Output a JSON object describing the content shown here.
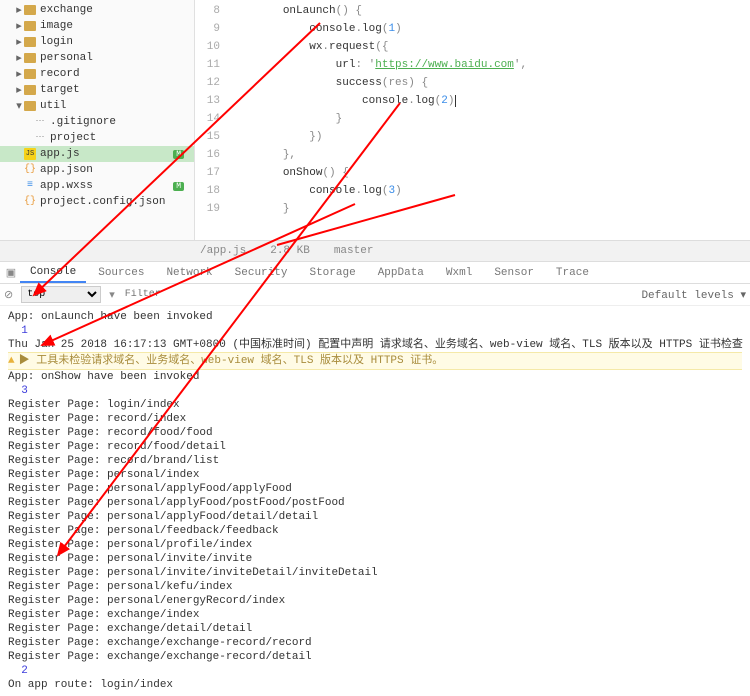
{
  "sidebar": {
    "items": [
      {
        "label": "exchange",
        "type": "folder",
        "open": false,
        "depth": 1
      },
      {
        "label": "image",
        "type": "folder",
        "open": false,
        "depth": 1
      },
      {
        "label": "login",
        "type": "folder",
        "open": false,
        "depth": 1
      },
      {
        "label": "personal",
        "type": "folder",
        "open": false,
        "depth": 1
      },
      {
        "label": "record",
        "type": "folder",
        "open": false,
        "depth": 1
      },
      {
        "label": "target",
        "type": "folder",
        "open": false,
        "depth": 1
      },
      {
        "label": "util",
        "type": "folder",
        "open": true,
        "depth": 1
      },
      {
        "label": ".gitignore",
        "type": "cfg",
        "depth": 2
      },
      {
        "label": "project",
        "type": "cfg",
        "depth": 2
      },
      {
        "label": "app.js",
        "type": "js",
        "badge": "M",
        "selected": true,
        "depth": 1
      },
      {
        "label": "app.json",
        "type": "json",
        "depth": 1
      },
      {
        "label": "app.wxss",
        "type": "wxss",
        "badge": "M",
        "depth": 1
      },
      {
        "label": "project.config.json",
        "type": "json",
        "depth": 1
      }
    ]
  },
  "editor": {
    "lines": [
      {
        "n": 8,
        "indent": 2,
        "tokens": [
          {
            "t": "onLaunch",
            "c": "fn"
          },
          {
            "t": "() {",
            "c": "punct"
          }
        ]
      },
      {
        "n": 9,
        "indent": 3,
        "tokens": [
          {
            "t": "console",
            "c": "kw"
          },
          {
            "t": ".",
            "c": "punct"
          },
          {
            "t": "log",
            "c": "fn"
          },
          {
            "t": "(",
            "c": "punct"
          },
          {
            "t": "1",
            "c": "num"
          },
          {
            "t": ")",
            "c": "punct"
          }
        ]
      },
      {
        "n": 10,
        "indent": 3,
        "tokens": [
          {
            "t": "wx",
            "c": "kw"
          },
          {
            "t": ".",
            "c": "punct"
          },
          {
            "t": "request",
            "c": "fn"
          },
          {
            "t": "({",
            "c": "punct"
          }
        ]
      },
      {
        "n": 11,
        "indent": 4,
        "tokens": [
          {
            "t": "url",
            "c": "kw"
          },
          {
            "t": ": '",
            "c": "punct"
          },
          {
            "t": "https://www.baidu.com",
            "c": "str"
          },
          {
            "t": "',",
            "c": "punct"
          }
        ]
      },
      {
        "n": 12,
        "indent": 4,
        "tokens": [
          {
            "t": "success",
            "c": "fn"
          },
          {
            "t": "(res) {",
            "c": "punct"
          }
        ]
      },
      {
        "n": 13,
        "indent": 5,
        "tokens": [
          {
            "t": "console",
            "c": "kw"
          },
          {
            "t": ".",
            "c": "punct"
          },
          {
            "t": "log",
            "c": "fn"
          },
          {
            "t": "(",
            "c": "punct"
          },
          {
            "t": "2",
            "c": "num"
          },
          {
            "t": ")",
            "c": "punct"
          }
        ],
        "cursor": true
      },
      {
        "n": 14,
        "indent": 4,
        "tokens": [
          {
            "t": "}",
            "c": "punct"
          }
        ]
      },
      {
        "n": 15,
        "indent": 3,
        "tokens": [
          {
            "t": "})",
            "c": "punct"
          }
        ]
      },
      {
        "n": 16,
        "indent": 2,
        "tokens": [
          {
            "t": "},",
            "c": "punct"
          }
        ]
      },
      {
        "n": 17,
        "indent": 2,
        "tokens": [
          {
            "t": "onShow",
            "c": "fn"
          },
          {
            "t": "() {",
            "c": "punct"
          }
        ]
      },
      {
        "n": 18,
        "indent": 3,
        "tokens": [
          {
            "t": "console",
            "c": "kw"
          },
          {
            "t": ".",
            "c": "punct"
          },
          {
            "t": "log",
            "c": "fn"
          },
          {
            "t": "(",
            "c": "punct"
          },
          {
            "t": "3",
            "c": "num"
          },
          {
            "t": ")",
            "c": "punct"
          }
        ]
      },
      {
        "n": 19,
        "indent": 2,
        "tokens": [
          {
            "t": "}",
            "c": "punct"
          }
        ]
      }
    ]
  },
  "statusbar": {
    "path": "/app.js",
    "size": "2.8 KB",
    "mode": "master"
  },
  "devtools": {
    "tabs": [
      "Console",
      "Sources",
      "Network",
      "Security",
      "Storage",
      "AppData",
      "Wxml",
      "Sensor",
      "Trace"
    ],
    "active": "Console",
    "top_label": "top",
    "filter_placeholder": "Filter",
    "levels": "Default levels ▾"
  },
  "console": {
    "lines": [
      {
        "text": "App: onLaunch have been invoked"
      },
      {
        "text": "1",
        "num": true
      },
      {
        "text": "Thu Jan 25 2018 16:17:13 GMT+0800 (中国标准时间) 配置中声明 请求域名、业务域名、web-view 域名、TLS 版本以及 HTTPS 证书检查"
      },
      {
        "text": "▶ 工具未检验请求域名、业务域名、web-view 域名、TLS 版本以及 HTTPS 证书。",
        "warn": true
      },
      {
        "text": "App: onShow have been invoked"
      },
      {
        "text": "3",
        "num": true
      },
      {
        "text": ""
      },
      {
        "text": "Register Page: login/index"
      },
      {
        "text": "Register Page: record/index"
      },
      {
        "text": "Register Page: record/food/food"
      },
      {
        "text": "Register Page: record/food/detail"
      },
      {
        "text": "Register Page: record/brand/list"
      },
      {
        "text": "Register Page: personal/index"
      },
      {
        "text": "Register Page: personal/applyFood/applyFood"
      },
      {
        "text": "Register Page: personal/applyFood/postFood/postFood"
      },
      {
        "text": "Register Page: personal/applyFood/detail/detail"
      },
      {
        "text": "Register Page: personal/feedback/feedback"
      },
      {
        "text": "Register Page: personal/profile/index"
      },
      {
        "text": "Register Page: personal/invite/invite"
      },
      {
        "text": "Register Page: personal/invite/inviteDetail/inviteDetail"
      },
      {
        "text": "Register Page: personal/kefu/index"
      },
      {
        "text": "Register Page: personal/energyRecord/index"
      },
      {
        "text": "Register Page: exchange/index"
      },
      {
        "text": "Register Page: exchange/detail/detail"
      },
      {
        "text": "Register Page: exchange/exchange-record/record"
      },
      {
        "text": "Register Page: exchange/exchange-record/detail"
      },
      {
        "text": "2",
        "num": true
      },
      {
        "text": "On app route: login/index"
      }
    ]
  }
}
